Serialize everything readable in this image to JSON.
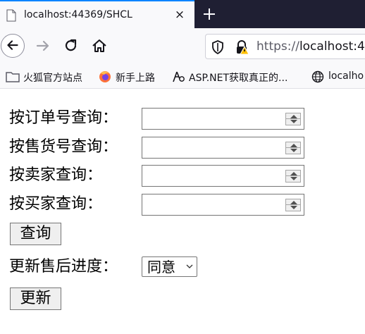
{
  "browser": {
    "tab": {
      "title": "localhost:44369/SHCL",
      "close_label": "×"
    },
    "url": {
      "scheme": "https://",
      "host": "localhost:44"
    },
    "bookmarks": [
      {
        "label": "火狐官方站点",
        "icon": "folder-icon"
      },
      {
        "label": "新手上路",
        "icon": "firefox-icon"
      },
      {
        "label": "ASP.NET获取真正的...",
        "icon": "aspnet-icon"
      },
      {
        "label": "localho",
        "icon": "globe-icon"
      }
    ]
  },
  "form": {
    "order_label": "按订单号查询：",
    "sale_label": "按售货号查询：",
    "seller_label": "按卖家查询：",
    "buyer_label": "按买家查询：",
    "order_value": "",
    "sale_value": "",
    "seller_value": "",
    "buyer_value": "",
    "query_button": "查询",
    "progress_label": "更新售后进度：",
    "progress_select": "同意",
    "update_button": "更新"
  },
  "colors": {
    "tabbar_bg": "#1f1f33",
    "tab_accent": "#0a84ff",
    "toolbar_bg": "#f9f9fb",
    "button_bg": "#efefef"
  }
}
